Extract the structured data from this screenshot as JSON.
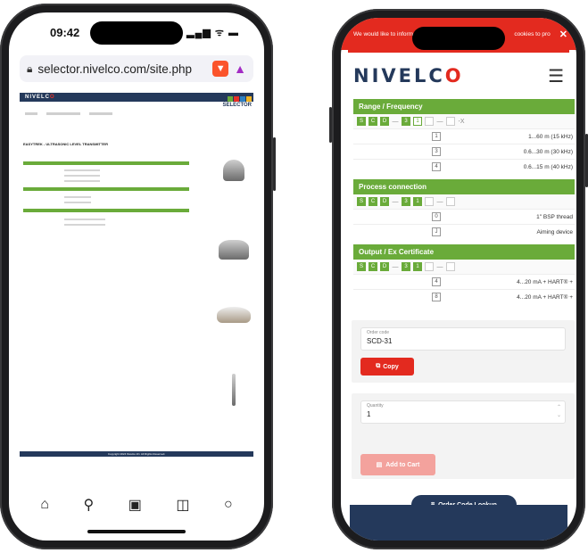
{
  "left_phone": {
    "status": {
      "time": "09:42",
      "icons": "▂▄▆ ᯤ ▬"
    },
    "url": "selector.nivelco.com/site.php",
    "mini_page": {
      "logo_main": "NIVELC",
      "logo_accent": "O",
      "selector_label": "SELECTOR",
      "title": "EASYTREK - ULTRASONIC LEVEL TRANSMITTER",
      "footer": "Copyright 2024 Nivelco Zrt. All Rights Reserved."
    },
    "bottom_icons": [
      "⌂",
      "⚲",
      "▣",
      "◫",
      "○"
    ]
  },
  "right_phone": {
    "cookie_text": "We would like to inform",
    "cookie_text_right": "cookies to pro",
    "cookie_close": "✕",
    "logo_main": "NIVELC",
    "logo_accent": "O",
    "sections": [
      {
        "title": "Range / Frequency",
        "chips": [
          "S",
          "C",
          "D",
          "—",
          "3",
          "1",
          "",
          "—",
          "",
          "-X"
        ],
        "options": [
          {
            "code": "1",
            "label": "1...60 m (15 kHz)"
          },
          {
            "code": "3",
            "label": "0.6...30 m (30 kHz)"
          },
          {
            "code": "4",
            "label": "0.6...15 m (40 kHz)"
          }
        ]
      },
      {
        "title": "Process connection",
        "chips": [
          "S",
          "C",
          "D",
          "—",
          "3",
          "1",
          "",
          "—",
          ""
        ],
        "options": [
          {
            "code": "0",
            "label": "1\" BSP thread"
          },
          {
            "code": "J",
            "label": "Aiming device"
          }
        ]
      },
      {
        "title": "Output / Ex Certificate",
        "chips": [
          "S",
          "C",
          "D",
          "—",
          "3",
          "1",
          "",
          "—",
          ""
        ],
        "options": [
          {
            "code": "4",
            "label": "4...20 mA + HART® +"
          },
          {
            "code": "8",
            "label": "4...20 mA + HART® +"
          }
        ]
      }
    ],
    "order_code": {
      "label": "Order code",
      "value": "SCD-31"
    },
    "copy_label": "Copy",
    "quantity": {
      "label": "Quantity",
      "value": "1"
    },
    "add_to_cart": "Add to Cart",
    "order_lookup": "Order Code Lookup"
  }
}
